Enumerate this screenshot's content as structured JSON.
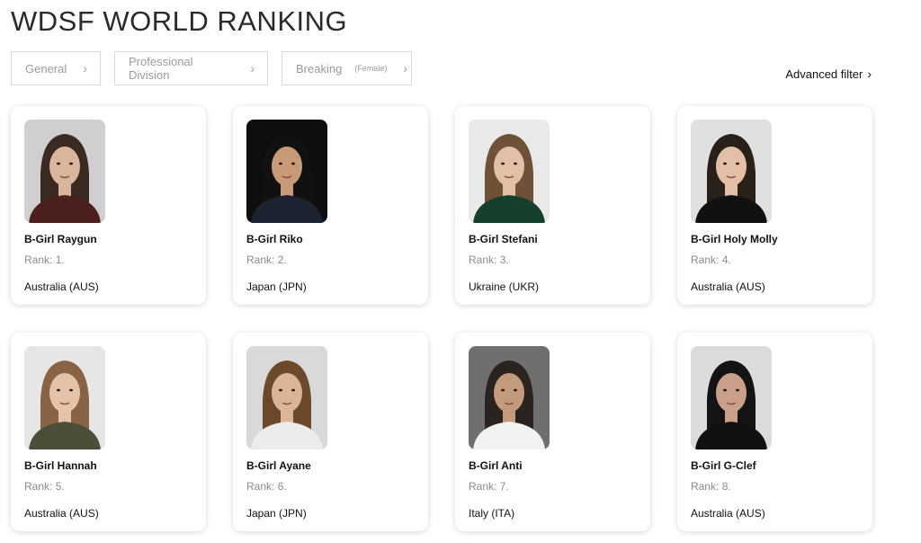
{
  "title": "WDSF WORLD RANKING",
  "filters": {
    "general": "General",
    "division": "Professional Division",
    "style": "Breaking",
    "style_sub": "(Female)"
  },
  "advanced_filter": "Advanced filter",
  "athletes": [
    {
      "name": "B-Girl Raygun",
      "rank_label": "Rank:",
      "rank": "1.",
      "country": "Australia (AUS)",
      "bg": "#cfcfcf",
      "hair": "#3a2a22",
      "skin": "#d9b59c",
      "shirt": "#4a1f1c"
    },
    {
      "name": "B-Girl Riko",
      "rank_label": "Rank:",
      "rank": "2.",
      "country": "Japan (JPN)",
      "bg": "#0e0e0e",
      "hair": "#111111",
      "skin": "#c99a78",
      "shirt": "#1c2230"
    },
    {
      "name": "B-Girl Stefani",
      "rank_label": "Rank:",
      "rank": "3.",
      "country": "Ukraine (UKR)",
      "bg": "#e9e9e9",
      "hair": "#6e5137",
      "skin": "#e2c0a6",
      "shirt": "#15402c"
    },
    {
      "name": "B-Girl Holy Molly",
      "rank_label": "Rank:",
      "rank": "4.",
      "country": "Australia (AUS)",
      "bg": "#e0e0e0",
      "hair": "#2a201a",
      "skin": "#e2bfa6",
      "shirt": "#111111"
    },
    {
      "name": "B-Girl Hannah",
      "rank_label": "Rank:",
      "rank": "5.",
      "country": "Australia (AUS)",
      "bg": "#e6e6e6",
      "hair": "#8a6244",
      "skin": "#e5c3a8",
      "shirt": "#4a4f3a"
    },
    {
      "name": "B-Girl Ayane",
      "rank_label": "Rank:",
      "rank": "6.",
      "country": "Japan (JPN)",
      "bg": "#d9d9d9",
      "hair": "#6b4a2c",
      "skin": "#dcb596",
      "shirt": "#ececec"
    },
    {
      "name": "B-Girl Anti",
      "rank_label": "Rank:",
      "rank": "7.",
      "country": "Italy (ITA)",
      "bg": "#6f6f6f",
      "hair": "#2a2320",
      "skin": "#c39a7b",
      "shirt": "#f2f2f2"
    },
    {
      "name": "B-Girl G-Clef",
      "rank_label": "Rank:",
      "rank": "8.",
      "country": "Australia (AUS)",
      "bg": "#dcdcdc",
      "hair": "#141414",
      "skin": "#caa08a",
      "shirt": "#111111"
    }
  ]
}
